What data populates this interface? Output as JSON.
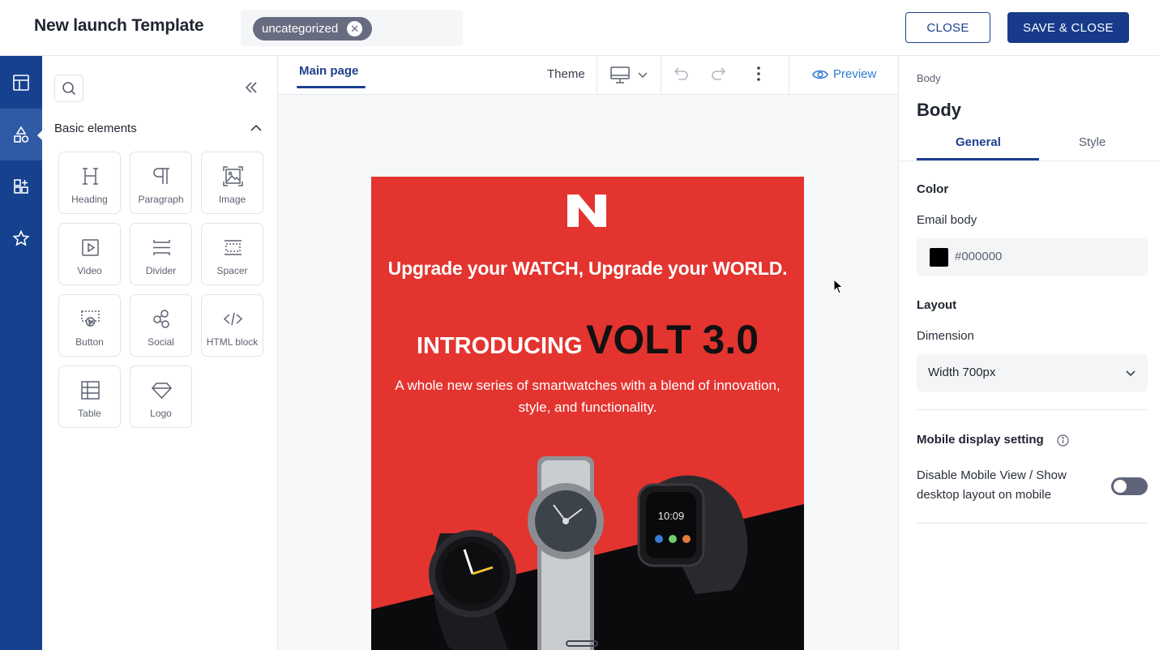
{
  "header": {
    "title": "New launch Template",
    "tag": "uncategorized",
    "close_label": "CLOSE",
    "save_label": "SAVE & CLOSE"
  },
  "rail": {
    "items": [
      "layout-icon",
      "elements-icon",
      "add-block-icon",
      "star-icon"
    ],
    "active_index": 1
  },
  "elements_panel": {
    "section_title": "Basic elements",
    "tiles": [
      {
        "label": "Heading",
        "icon": "heading-icon"
      },
      {
        "label": "Paragraph",
        "icon": "paragraph-icon"
      },
      {
        "label": "Image",
        "icon": "image-icon"
      },
      {
        "label": "Video",
        "icon": "video-icon"
      },
      {
        "label": "Divider",
        "icon": "divider-icon"
      },
      {
        "label": "Spacer",
        "icon": "spacer-icon"
      },
      {
        "label": "Button",
        "icon": "button-icon"
      },
      {
        "label": "Social",
        "icon": "social-icon"
      },
      {
        "label": "HTML block",
        "icon": "code-icon"
      },
      {
        "label": "Table",
        "icon": "table-icon"
      },
      {
        "label": "Logo",
        "icon": "logo-icon"
      }
    ]
  },
  "toolbar": {
    "tab_main": "Main page",
    "theme": "Theme",
    "preview": "Preview"
  },
  "email": {
    "headline": "Upgrade your WATCH, Upgrade your WORLD.",
    "intro_small": "INTRODUCING",
    "intro_big": "VOLT 3.0",
    "body_line1": "A whole new series of smartwatches with a blend of innovation,",
    "body_line2": "style, and functionality.",
    "watch_time": "10:09"
  },
  "props": {
    "crumb": "Body",
    "title": "Body",
    "tab_general": "General",
    "tab_style": "Style",
    "color_heading": "Color",
    "email_body_label": "Email body",
    "email_body_color": "#000000",
    "layout_heading": "Layout",
    "dimension_label": "Dimension",
    "dimension_value": "Width 700px",
    "mobile_heading": "Mobile display setting",
    "mobile_text": "Disable Mobile View / Show desktop layout on mobile",
    "mobile_toggle_on": false
  },
  "colors": {
    "brand": "#173b8a",
    "rail": "#15418f",
    "email_red": "#e3342f",
    "link": "#2f7bd0"
  }
}
